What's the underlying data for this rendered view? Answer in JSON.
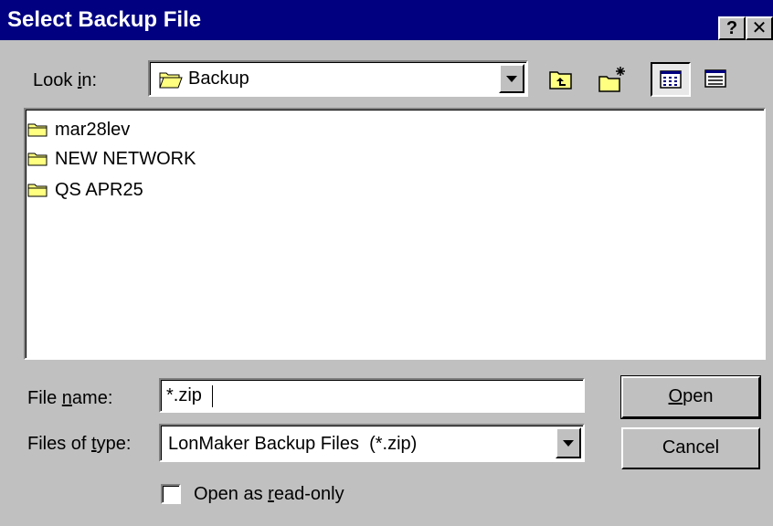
{
  "window": {
    "title": "Select Backup File",
    "help_glyph": "?",
    "close_glyph": "✕"
  },
  "lookin": {
    "label_prefix": "Look ",
    "label_mnemonic": "i",
    "label_suffix": "n:",
    "value": "Backup",
    "icon": "open-folder-icon"
  },
  "toolbar": {
    "icons": [
      "up-one-level-icon",
      "create-new-folder-icon",
      "list-view-icon",
      "details-view-icon"
    ]
  },
  "files": [
    {
      "name": "mar28lev",
      "icon": "folder-icon"
    },
    {
      "name": "NEW NETWORK",
      "icon": "folder-icon"
    },
    {
      "name": "QS APR25",
      "icon": "folder-icon"
    }
  ],
  "filename": {
    "label_prefix": "File ",
    "label_mnemonic": "n",
    "label_suffix": "ame:",
    "value": "*.zip"
  },
  "filetype": {
    "label_prefix": "Files of ",
    "label_mnemonic": "t",
    "label_suffix": "ype:",
    "value": "LonMaker Backup Files  (*.zip)"
  },
  "buttons": {
    "open_mnemonic": "O",
    "open_rest": "pen",
    "cancel": "Cancel"
  },
  "readonly": {
    "label_prefix": "Open as ",
    "label_mnemonic": "r",
    "label_suffix": "ead-only",
    "checked": false
  },
  "colors": {
    "titlebar": "#000080",
    "face": "#c0c0c0",
    "folder": "#ffff80"
  }
}
